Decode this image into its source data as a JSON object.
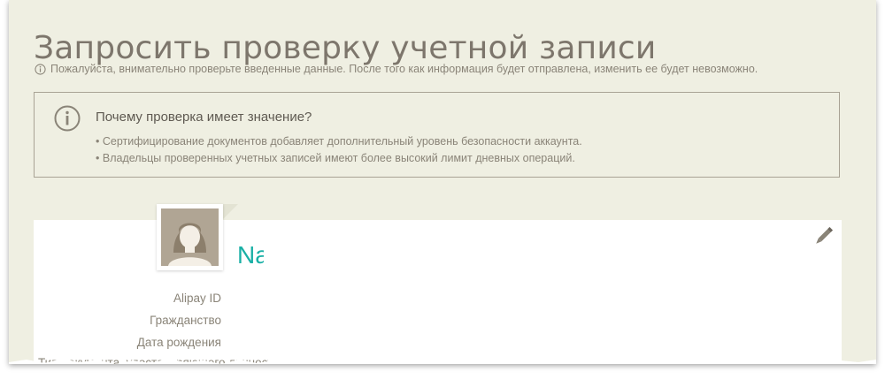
{
  "page": {
    "title": "Запросить проверку учетной записи",
    "notice": "Пожалуйста, внимательно проверьте введенные данные. После того как информация будет отправлена, изменить ее будет невозможно."
  },
  "why_box": {
    "title": "Почему проверка имеет значение?",
    "points": [
      "Сертифицирование документов добавляет дополнительный уровень безопасности аккаунта.",
      "Владельцы проверенных учетных записей имеют более высокий лимит дневных операций."
    ]
  },
  "profile": {
    "name_partial": "Na",
    "fields": [
      {
        "label": "Alipay ID"
      },
      {
        "label": "Гражданство"
      },
      {
        "label": "Дата рождения"
      },
      {
        "label": "Тип документа, удостоверяющего личность"
      }
    ]
  },
  "icons": {
    "notice": "info-icon",
    "why_box": "info-circle-icon",
    "edit": "pencil-icon",
    "avatar": "avatar-placeholder-icon"
  },
  "colors": {
    "background": "#efefe2",
    "title_text": "#7d766c",
    "body_text": "#8a8478",
    "accent": "#1ab0a6",
    "card": "#ffffff"
  }
}
